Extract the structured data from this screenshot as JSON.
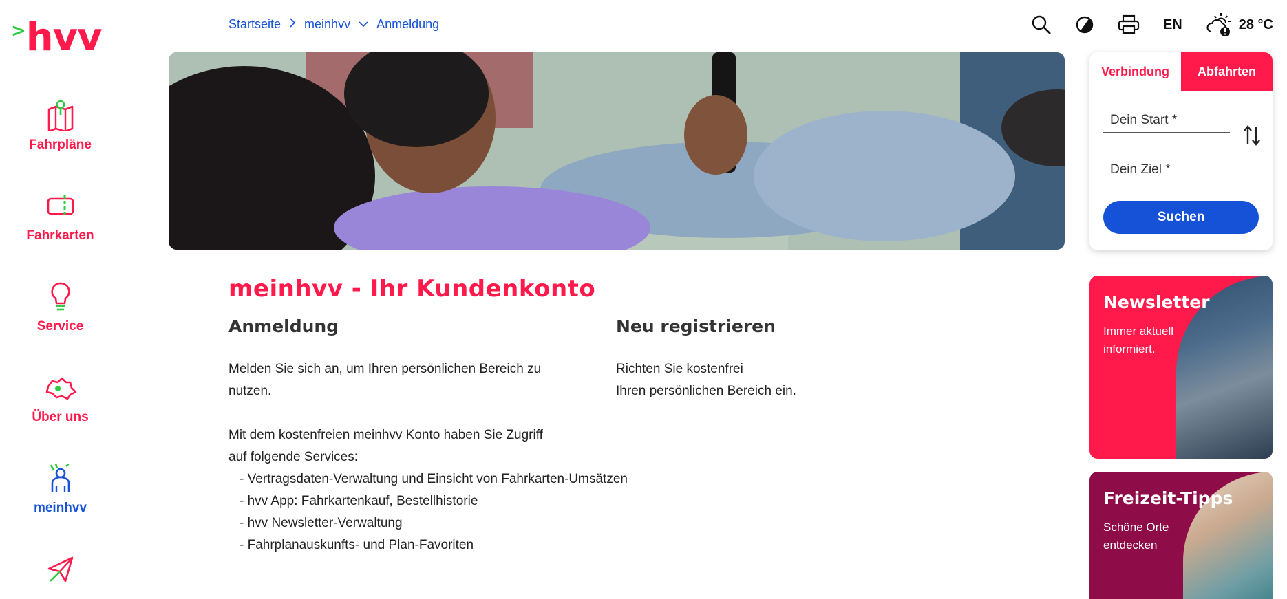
{
  "logo": {
    "text": "hvv"
  },
  "breadcrumb": {
    "items": [
      "Startseite",
      "meinhvv",
      "Anmeldung"
    ]
  },
  "tools": {
    "language": "EN",
    "temperature": "28 °C"
  },
  "sidebar": {
    "items": [
      {
        "label": "Fahrpläne",
        "icon": "map-icon"
      },
      {
        "label": "Fahrkarten",
        "icon": "ticket-icon"
      },
      {
        "label": "Service",
        "icon": "lightbulb-icon"
      },
      {
        "label": "Über uns",
        "icon": "hamburg-map-icon"
      },
      {
        "label": "meinhvv",
        "icon": "person-icon",
        "active": true
      },
      {
        "label": "",
        "icon": "paper-plane-icon"
      }
    ]
  },
  "main": {
    "title": "meinhvv - Ihr Kundenkonto",
    "login": {
      "heading": "Anmeldung",
      "intro_1": "Melden Sie sich an, um Ihren persönlichen Bereich zu",
      "intro_2": "nutzen.",
      "services_1": "Mit dem kostenfreien meinhvv Konto haben Sie Zugriff",
      "services_2": "auf folgende Services:",
      "list": [
        "- Vertragsdaten-Verwaltung und Einsicht von Fahrkarten-Umsätzen",
        "- hvv App: Fahrkartenkauf, Bestellhistorie",
        "- hvv Newsletter-Verwaltung",
        "- Fahrplanauskunfts- und Plan-Favoriten"
      ]
    },
    "register": {
      "heading": "Neu registrieren",
      "line_1": "Richten Sie kostenfrei",
      "line_2": "Ihren persönlichen Bereich ein."
    }
  },
  "widget": {
    "tab_connection": "Verbindung",
    "tab_departures": "Abfahrten",
    "start_placeholder": "Dein Start *",
    "destination_placeholder": "Dein Ziel *",
    "search_label": "Suchen"
  },
  "cards": {
    "newsletter": {
      "title": "Newsletter",
      "text": "Immer aktuell informiert."
    },
    "leisure": {
      "title": "Freizeit-Tipps",
      "text": "Schöne Orte entdecken"
    }
  },
  "colors": {
    "brand_red": "#ff1a4b",
    "brand_blue": "#1652d8",
    "brand_green": "#2ecc40",
    "leisure_purple": "#8e0d48"
  }
}
